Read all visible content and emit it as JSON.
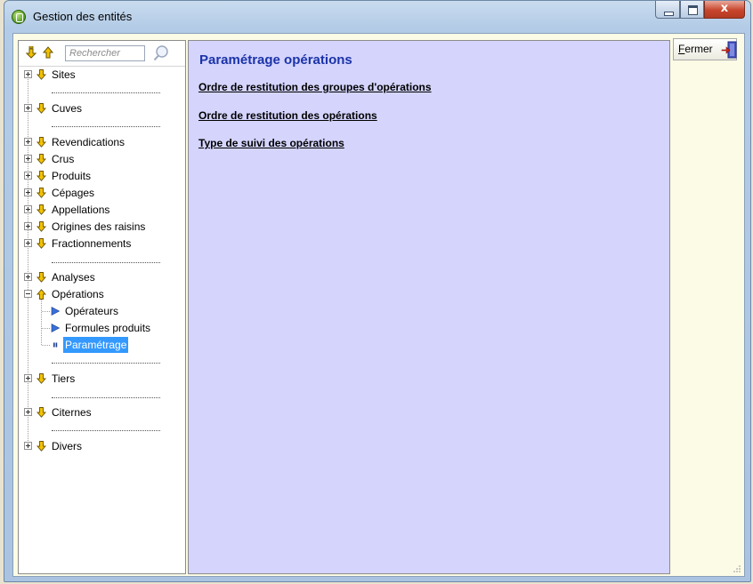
{
  "window": {
    "title": "Gestion des entités",
    "close_glyph": "x"
  },
  "search": {
    "placeholder": "Rechercher"
  },
  "tree": {
    "items": [
      {
        "label": "Sites",
        "expander": "plus",
        "icon": "arrow-down-icon"
      },
      {
        "label": "Cuves",
        "expander": "plus",
        "icon": "arrow-down-icon"
      },
      {
        "label": "Revendications",
        "expander": "plus",
        "icon": "arrow-down-icon"
      },
      {
        "label": "Crus",
        "expander": "plus",
        "icon": "arrow-down-icon"
      },
      {
        "label": "Produits",
        "expander": "plus",
        "icon": "arrow-down-icon"
      },
      {
        "label": "Cépages",
        "expander": "plus",
        "icon": "arrow-down-icon"
      },
      {
        "label": "Appellations",
        "expander": "plus",
        "icon": "arrow-down-icon"
      },
      {
        "label": "Origines des raisins",
        "expander": "plus",
        "icon": "arrow-down-icon"
      },
      {
        "label": "Fractionnements",
        "expander": "plus",
        "icon": "arrow-down-icon"
      },
      {
        "label": "Analyses",
        "expander": "plus",
        "icon": "arrow-down-icon"
      },
      {
        "label": "Opérations",
        "expander": "minus",
        "icon": "arrow-up-icon"
      },
      {
        "label": "Tiers",
        "expander": "plus",
        "icon": "arrow-down-icon"
      },
      {
        "label": "Citernes",
        "expander": "plus",
        "icon": "arrow-down-icon"
      },
      {
        "label": "Divers",
        "expander": "plus",
        "icon": "arrow-down-icon"
      }
    ],
    "operations_children": [
      {
        "label": "Opérateurs",
        "icon": "play-icon"
      },
      {
        "label": "Formules produits",
        "icon": "play-icon"
      },
      {
        "label": "Paramétrage",
        "icon": "pause-icon",
        "selected": true
      }
    ]
  },
  "main": {
    "title": "Paramétrage opérations",
    "links": [
      "Ordre de restitution des groupes d'opérations",
      "Ordre de restitution des opérations",
      "Type de suivi des opérations"
    ]
  },
  "actions": {
    "fermer_label": "Fermer"
  },
  "colors": {
    "main_bg": "#d4d4fd",
    "title_blue": "#1b33a8",
    "selected_bg": "#3399ff",
    "arrow_yellow": "#f2c200",
    "client_bg": "#fbfbe6"
  }
}
